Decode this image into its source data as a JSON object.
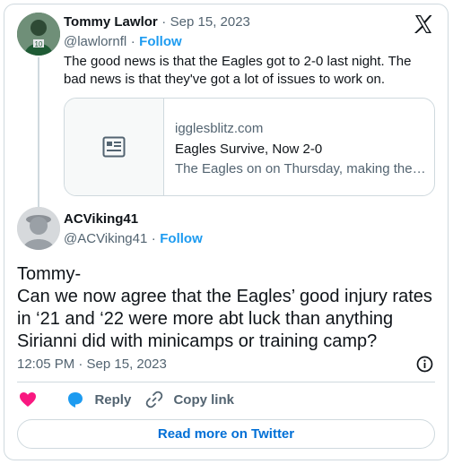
{
  "parent_tweet": {
    "author_name": "Tommy Lawlor",
    "separator": "·",
    "date": "Sep 15, 2023",
    "handle": "@lawlornfl",
    "follow_label": "Follow",
    "text": "The good news is that the Eagles got to 2-0 last night. The bad news is that they've got a lot of issues to work on.",
    "link_card": {
      "domain": "igglesblitz.com",
      "title": "Eagles Survive, Now 2-0",
      "description": "The Eagles on on Thursday, making the…",
      "icon": "article-icon"
    }
  },
  "x_logo": "x-logo",
  "tweet": {
    "author_name": "ACViking41",
    "handle": "@ACViking41",
    "separator": "·",
    "follow_label": "Follow",
    "text_line1": "Tommy-",
    "text_body": "Can we now agree that the Eagles’ good injury rates in ‘21 and ‘22 were more abt luck than anything Sirianni did with minicamps or training camp?",
    "time": "12:05 PM · Sep 15, 2023"
  },
  "actions": {
    "like_icon": "heart-icon",
    "reply_label": "Reply",
    "copy_link_label": "Copy link"
  },
  "read_more_label": "Read more on Twitter",
  "colors": {
    "accent": "#1d9bf0",
    "like": "#f91880",
    "muted": "#536471",
    "border": "#cfd9de"
  }
}
